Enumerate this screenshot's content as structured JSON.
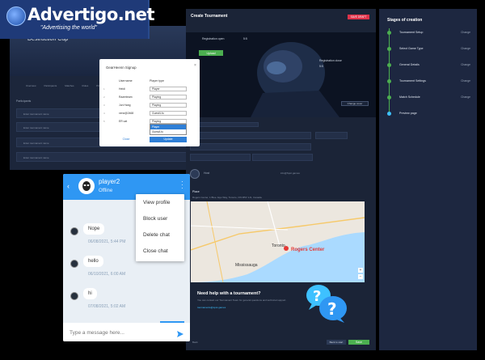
{
  "logo": {
    "title": "Advertigo.net",
    "tagline": "\"Advertising the world\""
  },
  "back_window": {
    "heading": "Destruction Cup",
    "tabs": [
      "Overview",
      "Participants",
      "Matches",
      "Rules",
      "Prize",
      "Streams"
    ],
    "action_label": "Submit",
    "section_title": "Participants",
    "rows": [
      "Enter tournament name",
      "Enter tournament name",
      "Enter tournament name",
      "Enter tournament name"
    ]
  },
  "modal": {
    "title": "GearHeenn Signup",
    "col_username": "Username",
    "col_player_type": "Player type",
    "rows": [
      {
        "name": "Heidi",
        "type": "Player"
      },
      {
        "name": "Razerteam",
        "type": "Playing"
      },
      {
        "name": "Jun Hang",
        "type": "Playing"
      },
      {
        "name": "xenx@2468",
        "type": "Guest/Lfo"
      },
      {
        "name": "ER cat",
        "type": "Playing"
      }
    ],
    "dropdown_options": [
      "Player",
      "Guest/Lfo"
    ],
    "cancel_label": "Close",
    "save_label": "Update"
  },
  "tournament": {
    "title": "Create Tournament",
    "save_draft": "SAVE DRAFT",
    "reg_open_label": "Registration open",
    "reg_open_value": "5:5",
    "reg_close_label": "Registration close",
    "reg_close_value": "5:5",
    "upload_label": "Upload",
    "change_cover": "Change cover",
    "host_name": "Host",
    "contact": "info@Spot.games",
    "place_title": "Place",
    "address": "Rogers Center, 1 Blue Jays Way, Toronto, ON M5V 1J1, Canada",
    "map": {
      "city_label": "Toronto",
      "place_label": "Rogers Center",
      "suburb_label": "Mississauga",
      "zoom_in": "+",
      "zoom_out": "−"
    },
    "help_title": "Need help with a tournament?",
    "help_text": "You can contact our Tournament Team for general questions and technical support.",
    "help_email": "tournaments@spot.games",
    "back_label": "Back",
    "prev_label": "Back to start",
    "next_label": "Save"
  },
  "stages": {
    "title": "Stages of creation",
    "items": [
      {
        "label": "Tournament Setup",
        "action": "Change"
      },
      {
        "label": "Select Game Type",
        "action": "Change"
      },
      {
        "label": "General Details",
        "action": "Change"
      },
      {
        "label": "Tournament Settings",
        "action": "Change"
      },
      {
        "label": "Match Schedule",
        "action": "Change"
      },
      {
        "label": "Preview page",
        "action": ""
      }
    ],
    "colors": {
      "done": "#4caf50",
      "current": "#3ec1ff"
    }
  },
  "chat": {
    "username": "player2",
    "status": "Offline",
    "messages": [
      {
        "text": "Nope",
        "time": "06/08/2021, 5:44 PM"
      },
      {
        "text": "hello",
        "time": "06/10/2021, 6:00 AM"
      },
      {
        "text": "hi",
        "time": "07/08/2021, 5:02 AM"
      }
    ],
    "input_placeholder": "Type a message here...",
    "menu_items": [
      "View profile",
      "Block user",
      "Delete chat",
      "Close chat"
    ],
    "header_color": "#2f97f3"
  }
}
